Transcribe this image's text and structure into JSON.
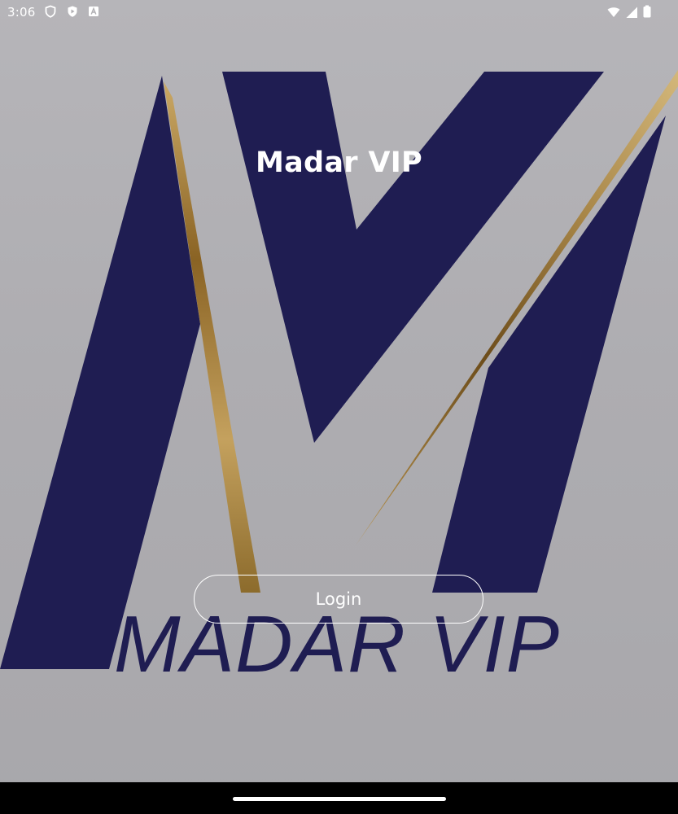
{
  "status_bar": {
    "time": "3:06",
    "left_icons": [
      "shield-icon",
      "play-protect-icon",
      "text-input-icon"
    ],
    "right_icons": [
      "wifi-icon",
      "cellular-icon",
      "battery-icon"
    ]
  },
  "main": {
    "title": "Madar VIP",
    "login_label": "Login"
  },
  "logo": {
    "wordmark": "MADAR VIP",
    "colors": {
      "navy": "#1f1d52",
      "gold": "#b99655",
      "background": "#b0afb3"
    }
  },
  "colors": {
    "text": "#ffffff",
    "nav_bar": "#000000"
  }
}
